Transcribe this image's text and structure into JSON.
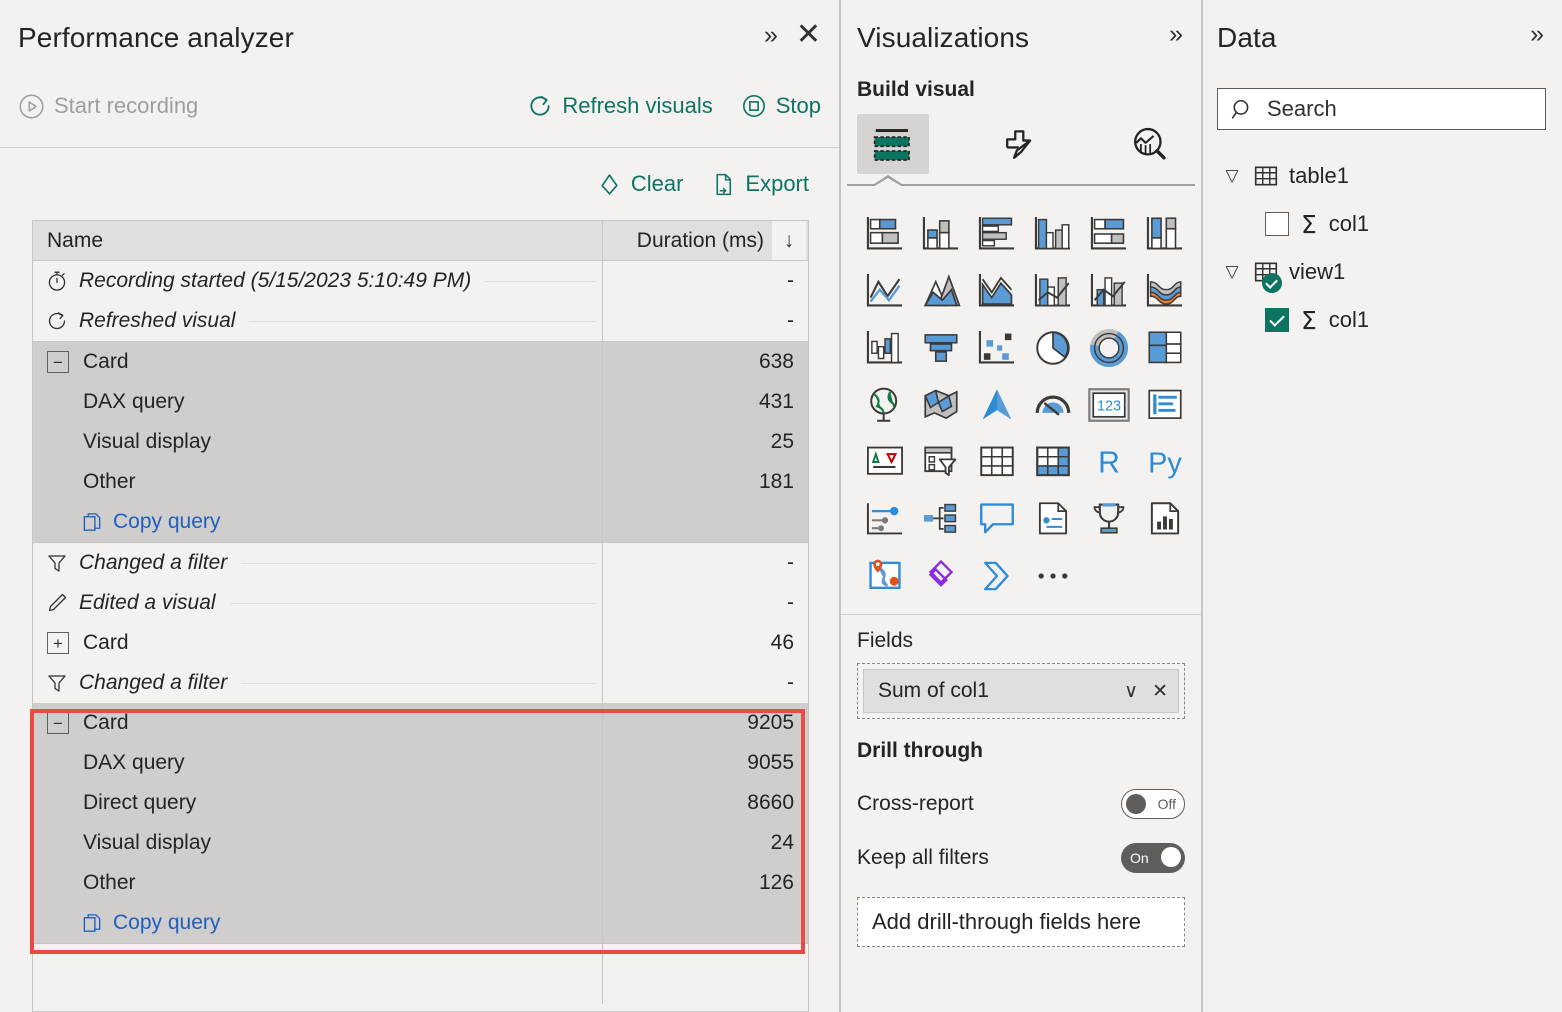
{
  "performance_analyzer": {
    "title": "Performance analyzer",
    "header_actions": [
      {
        "name": "expand",
        "glyph": "»"
      },
      {
        "name": "close",
        "glyph": "✕"
      }
    ],
    "toolbar": {
      "start_recording": "Start recording",
      "refresh_visuals": "Refresh visuals",
      "stop": "Stop"
    },
    "subtoolbar": {
      "clear": "Clear",
      "export": "Export"
    },
    "table": {
      "columns": [
        "Name",
        "Duration (ms)"
      ],
      "sort_indicator": "↓",
      "groups": [
        {
          "type": "events",
          "highlighted": false,
          "rows": [
            {
              "kind": "event",
              "icon": "stopwatch-icon",
              "label": "Recording started (5/15/2023 5:10:49 PM)",
              "duration": "-"
            },
            {
              "kind": "event",
              "icon": "refresh-icon",
              "label": "Refreshed visual",
              "duration": "-"
            }
          ]
        },
        {
          "type": "visual",
          "highlighted": false,
          "expanded": true,
          "rows": [
            {
              "kind": "parent",
              "expander": "−",
              "label": "Card",
              "duration": "638"
            },
            {
              "kind": "child",
              "label": "DAX query",
              "duration": "431"
            },
            {
              "kind": "child",
              "label": "Visual display",
              "duration": "25"
            },
            {
              "kind": "child",
              "label": "Other",
              "duration": "181"
            },
            {
              "kind": "copy",
              "label": "Copy query",
              "duration": ""
            }
          ]
        },
        {
          "type": "events",
          "highlighted": false,
          "rows": [
            {
              "kind": "event",
              "icon": "filter-icon",
              "label": "Changed a filter",
              "duration": "-"
            },
            {
              "kind": "event",
              "icon": "pencil-icon",
              "label": "Edited a visual",
              "duration": "-"
            },
            {
              "kind": "parent-collapsed",
              "expander": "+",
              "label": "Card",
              "duration": "46"
            },
            {
              "kind": "event",
              "icon": "filter-icon",
              "label": "Changed a filter",
              "duration": "-"
            }
          ]
        },
        {
          "type": "visual",
          "highlighted": true,
          "expanded": true,
          "rows": [
            {
              "kind": "parent",
              "expander": "−",
              "label": "Card",
              "duration": "9205"
            },
            {
              "kind": "child",
              "label": "DAX query",
              "duration": "9055"
            },
            {
              "kind": "child",
              "label": "Direct query",
              "duration": "8660"
            },
            {
              "kind": "child",
              "label": "Visual display",
              "duration": "24"
            },
            {
              "kind": "child",
              "label": "Other",
              "duration": "126"
            },
            {
              "kind": "copy",
              "label": "Copy query",
              "duration": ""
            }
          ]
        }
      ]
    }
  },
  "visualizations": {
    "title": "Visualizations",
    "expand_glyph": "»",
    "build_visual_label": "Build visual",
    "build_tabs": [
      {
        "name": "fields-tab",
        "selected": true
      },
      {
        "name": "format-tab",
        "selected": false
      },
      {
        "name": "analytics-tab",
        "selected": false
      }
    ],
    "visual_types": [
      "stacked-bar-chart",
      "stacked-column-chart",
      "clustered-bar-chart",
      "clustered-column-chart",
      "100-percent-stacked-bar-chart",
      "100-percent-stacked-column-chart",
      "line-chart",
      "area-chart",
      "stacked-area-chart",
      "line-and-stacked-column-chart",
      "line-and-clustered-column-chart",
      "ribbon-chart",
      "waterfall-chart",
      "funnel-chart",
      "scatter-chart",
      "pie-chart",
      "donut-chart",
      "treemap",
      "map",
      "filled-map",
      "azure-map",
      "gauge-chart",
      "card",
      "multi-row-card",
      "kpi",
      "slicer",
      "table",
      "matrix",
      "r-script-visual",
      "python-visual",
      "key-influencers",
      "decomposition-tree",
      "q-and-a",
      "smart-narrative",
      "paginated-report",
      "metrics-visual",
      "arcgis-maps",
      "power-apps",
      "power-automate",
      "more-options"
    ],
    "fields": {
      "section_label": "Fields",
      "chip_label": "Sum of col1",
      "chip_dropdown_glyph": "∨",
      "chip_remove_glyph": "✕"
    },
    "drill_through": {
      "section_label": "Drill through",
      "rows": [
        {
          "label": "Cross-report",
          "state": "Off",
          "on": false
        },
        {
          "label": "Keep all filters",
          "state": "On",
          "on": true
        }
      ],
      "drop_zone_label": "Add drill-through fields here"
    }
  },
  "data_panel": {
    "title": "Data",
    "expand_glyph": "»",
    "search_placeholder": "Search",
    "tree": [
      {
        "name": "table1",
        "expanded": true,
        "icon": "table-icon",
        "badge": false,
        "children": [
          {
            "name": "col1",
            "checked": false,
            "icon": "sigma-icon",
            "sigma": "Σ"
          }
        ]
      },
      {
        "name": "view1",
        "expanded": true,
        "icon": "table-icon",
        "badge": true,
        "children": [
          {
            "name": "col1",
            "checked": true,
            "icon": "sigma-icon",
            "sigma": "Σ"
          }
        ]
      }
    ]
  },
  "colors": {
    "accent_teal": "#0e7462",
    "link_blue": "#1f5fbf",
    "highlight_red": "#ea4c43",
    "panel_bg": "#f3f2f1",
    "row_selected_bg": "#cfcecd",
    "header_bg": "#e1dfdd"
  }
}
